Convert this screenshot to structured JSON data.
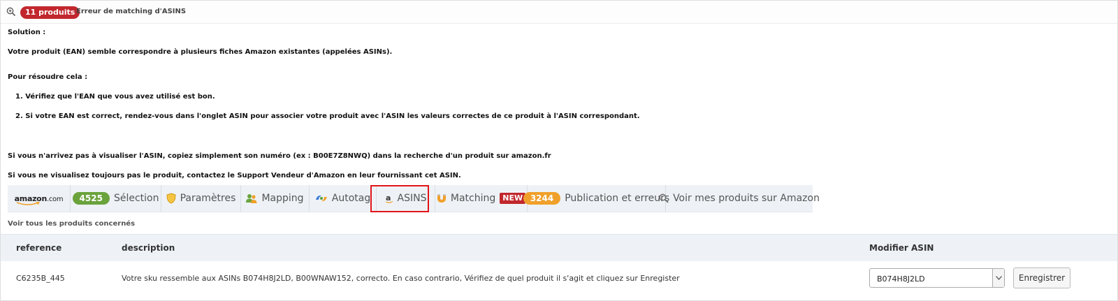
{
  "header": {
    "count_badge": "11 produits",
    "title": "Erreur de matching d'ASINS"
  },
  "message": {
    "solution_label": "Solution :",
    "line1": "Votre produit (EAN) semble correspondre à plusieurs fiches Amazon existantes (appelées ASINs).",
    "resolve_label": "Pour résoudre cela :",
    "step1": "1. Vérifiez que l'EAN que vous avez utilisé est bon.",
    "step2": "2. Si votre EAN est correct, rendez-vous dans l'onglet ASIN pour associer votre produit avec l'ASIN les valeurs correctes de ce produit à l'ASIN correspondant.",
    "hint1": "Si vous n'arrivez pas à visualiser l'ASIN, copiez simplement son numéro (ex : B00E7Z8NWQ) dans la recherche d'un produit sur amazon.fr",
    "hint2": "Si vous ne visualisez toujours pas le produit, contactez le Support Vendeur d'Amazon en leur fournissant cet ASIN."
  },
  "tabs": {
    "amazon_logo": "amazon",
    "amazon_logo_suffix": ".com",
    "selection_count": "4525",
    "selection_label": "Sélection",
    "settings_label": "Paramètres",
    "mapping_label": "Mapping",
    "autotag_label": "Autotag",
    "asins_label": "ASINS",
    "matching_label": "Matching",
    "new_badge": "NEW",
    "publication_count": "3244",
    "publication_label": "Publication et erreurs",
    "view_on_amazon_label": "Voir mes produits sur Amazon"
  },
  "see_all_label": "Voir tous les produits concernés",
  "table": {
    "headers": {
      "reference": "reference",
      "description": "description",
      "modify_asin": "Modifier ASIN"
    },
    "rows": [
      {
        "reference": "C6235B_445",
        "description": "Votre sku ressemble aux ASINs B074H8J2LD, B00WNAW152, correcto. En caso contrario, Vérifiez de quel produit il s'agit et cliquez sur Enregister",
        "asin_selected": "B074H8J2LD",
        "save_label": "Enregistrer"
      }
    ]
  },
  "colors": {
    "badge_red": "#c1272d",
    "pill_green": "#6aa33c",
    "pill_orange": "#f0a02a",
    "highlight": "#e3141b",
    "tabbar_bg": "#eef2f6"
  }
}
